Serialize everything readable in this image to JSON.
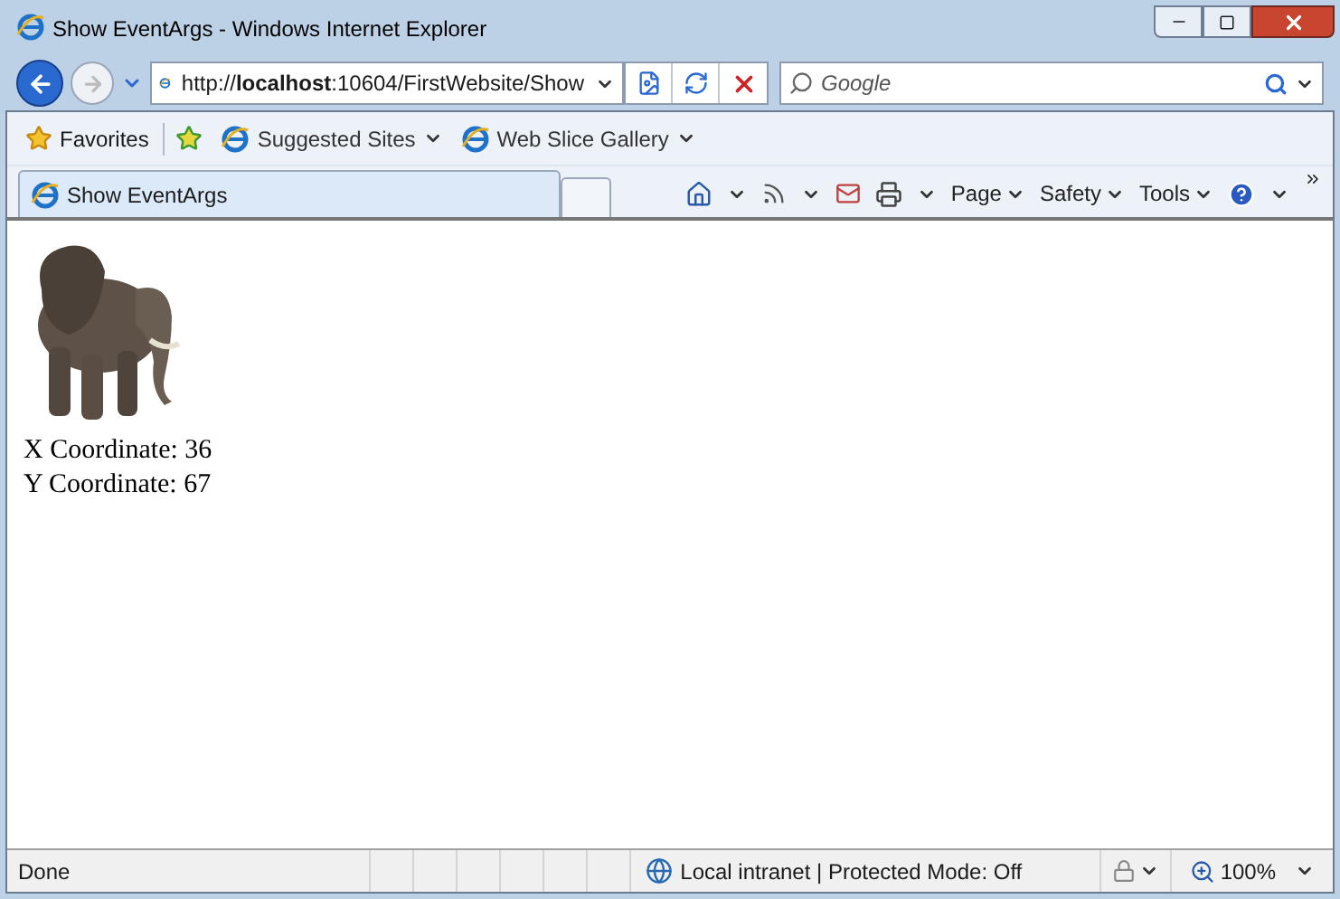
{
  "window": {
    "title": "Show EventArgs - Windows Internet Explorer"
  },
  "address_bar": {
    "value": "http://**localhost**:10604/FirstWebsite/Show"
  },
  "search": {
    "placeholder": "Google"
  },
  "favorites_bar": {
    "favorites": "Favorites",
    "links": [
      "Suggested Sites",
      "Web Slice Gallery"
    ]
  },
  "tabs": [
    {
      "label": "Show EventArgs",
      "selected": true
    }
  ],
  "command_bar": [
    "Page",
    "Safety",
    "Tools"
  ],
  "page": {
    "image": {
      "kind": "picture"
    },
    "lines": [
      "X Coordinate: 36",
      "Y Coordinate: 67"
    ]
  },
  "status_bar": {
    "status": "Done",
    "zone": "Local intranet | Protected Mode: Off",
    "zoom": "100%"
  }
}
